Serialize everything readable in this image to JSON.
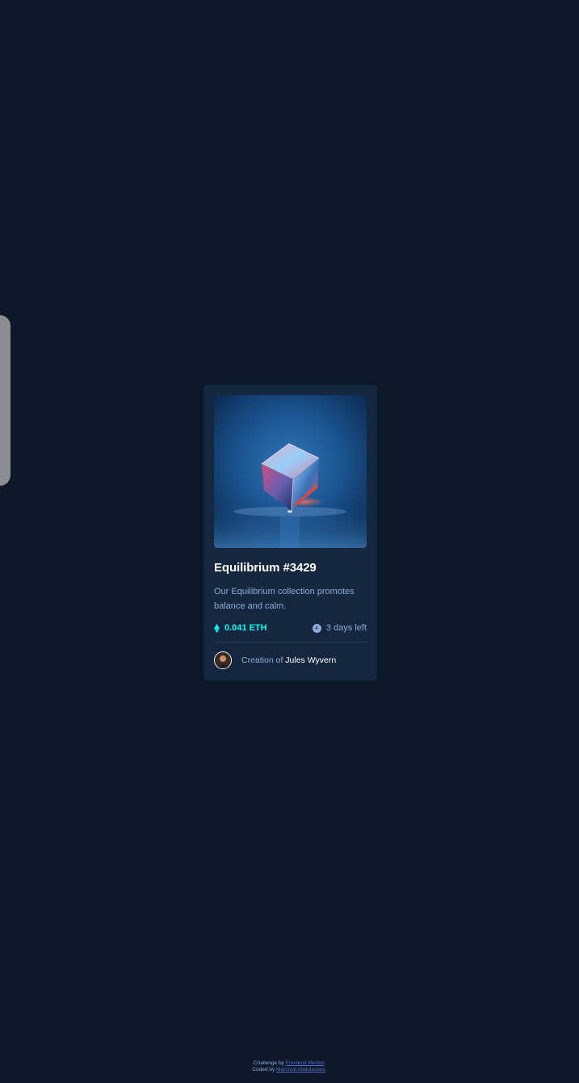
{
  "card": {
    "image_alt": "Equilibrium",
    "title": "Equilibrium #3429",
    "description": "Our Equilibrium collection promotes balance and calm.",
    "price": "0.041 ETH",
    "time_left": "3 days left",
    "creation_prefix": "Creation of",
    "creator_name": "Jules Wyvern",
    "icons": {
      "price": "ethereum-icon",
      "time": "clock-icon"
    }
  },
  "attribution": {
    "challenge_prefix": "Challenge by",
    "challenge_link": "Frontend Mentor",
    "coded_prefix": "Coded by",
    "coded_link": "Mahmud Abdulazeez",
    "suffix": "."
  },
  "colors": {
    "background": "#0d192b",
    "card": "#15263f",
    "cyan": "#00fff8",
    "soft_blue": "#8bacd9",
    "white": "#ffffff"
  }
}
